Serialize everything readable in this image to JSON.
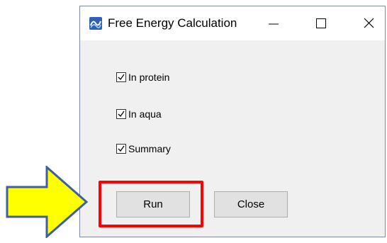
{
  "window": {
    "title": "Free Energy Calculation",
    "icon": "app-logo-icon",
    "controls": {
      "minimize": "minimize-icon",
      "maximize": "maximize-icon",
      "close": "close-icon"
    }
  },
  "options": [
    {
      "label": "In protein",
      "checked": true
    },
    {
      "label": "In aqua",
      "checked": true
    },
    {
      "label": "Summary",
      "checked": true
    }
  ],
  "buttons": {
    "run_label": "Run",
    "close_label": "Close"
  },
  "annotation": {
    "highlight_color": "#ff0000",
    "arrow_fill": "#ffff00",
    "arrow_outline": "#3f5fa0"
  }
}
